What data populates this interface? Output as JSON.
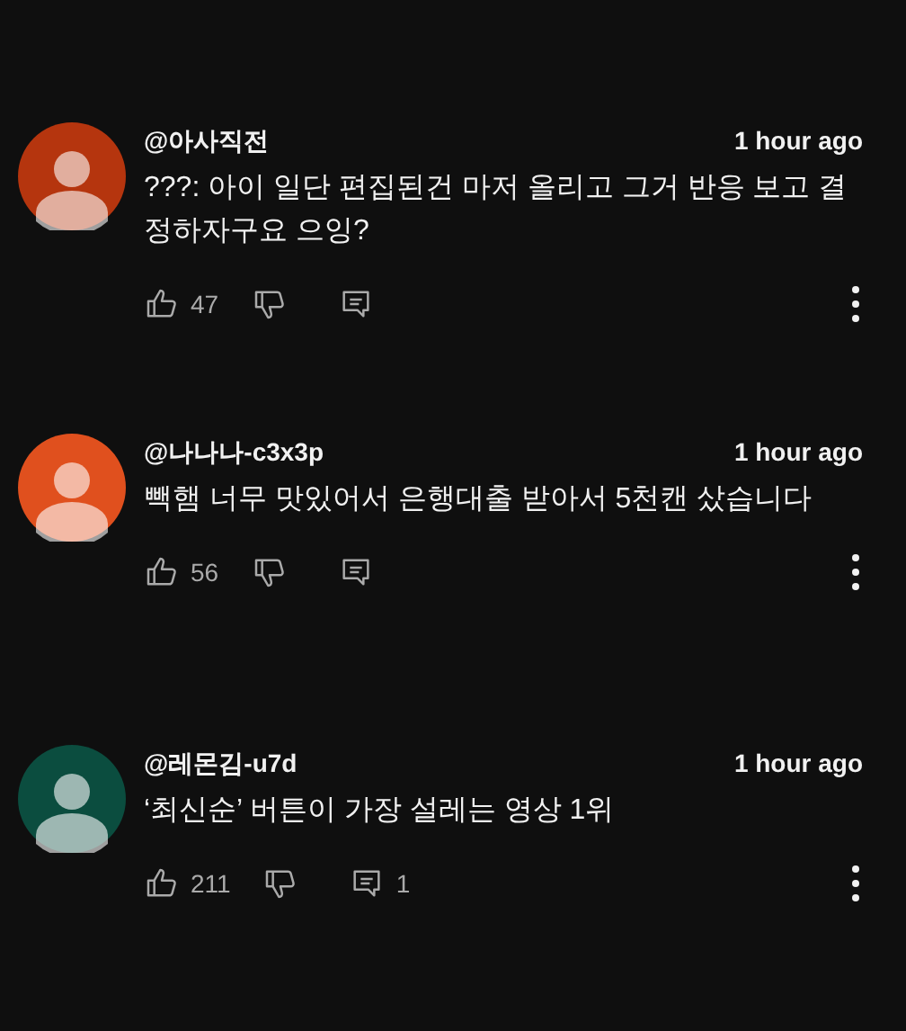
{
  "comments": [
    {
      "author": "@아사직전",
      "time": "1 hour ago",
      "text": "???: 아이 일단 편집된건 마저 올리고 그거 반응 보고 결정하자구요 으잉?",
      "likes": "47",
      "color": "#b5350e"
    },
    {
      "author": "@나나나-c3x3p",
      "time": "1 hour ago",
      "text": "빽햄 너무 맛있어서 은행대출 받아서 5천캔 샀습니다",
      "likes": "56",
      "color": "#e0501e"
    },
    {
      "author": "@레몬김-u7d",
      "time": "1 hour ago",
      "text": "‘최신순’ 버튼이 가장 설레는 영상 1위",
      "likes": "211",
      "color": "#0b4d3f",
      "replies": "1"
    }
  ]
}
